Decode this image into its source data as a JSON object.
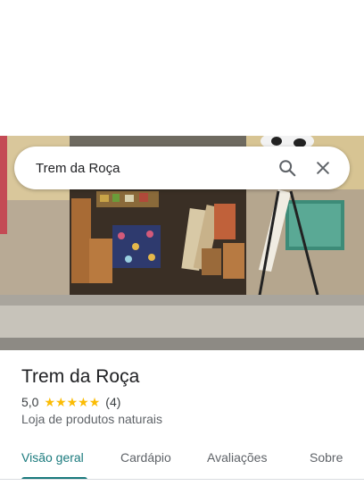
{
  "search": {
    "query": "Trem da Roça",
    "search_icon": "search-icon",
    "close_icon": "close-icon"
  },
  "place": {
    "name": "Trem da Roça",
    "rating": "5,0",
    "stars": 5,
    "review_count": "(4)",
    "category": "Loja de produtos naturais"
  },
  "tabs": [
    {
      "label": "Visão geral",
      "active": true
    },
    {
      "label": "Cardápio",
      "active": false
    },
    {
      "label": "Avaliações",
      "active": false
    },
    {
      "label": "Sobre",
      "active": false
    }
  ],
  "colors": {
    "accent": "#1a7a7d",
    "star": "#fbbc04"
  }
}
